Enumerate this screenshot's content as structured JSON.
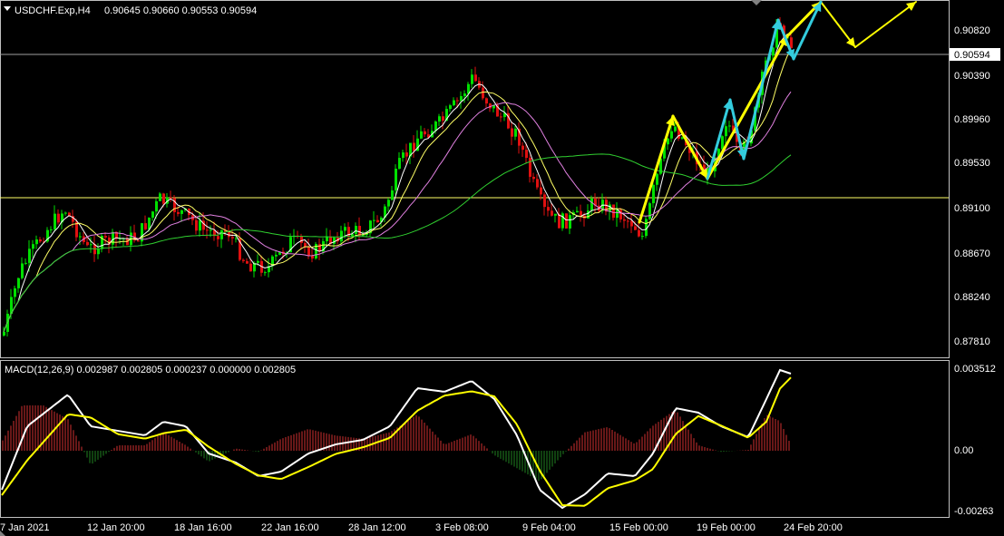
{
  "main_header": {
    "symbol": "USDCHF.Exp,H4",
    "ohlc": "0.90645 0.90660 0.90553 0.90594"
  },
  "macd_header": {
    "text": "MACD(12,26,9) 0.002987 0.002805 0.000237 0.000000 0.002805"
  },
  "price_axis": {
    "ticks": [
      "0.90820",
      "0.90390",
      "0.89960",
      "0.89530",
      "0.89100",
      "0.88670",
      "0.88240",
      "0.87810"
    ],
    "current_price": "0.90594"
  },
  "macd_axis": {
    "ticks": [
      "0.003512",
      "0.00",
      "-0.00263"
    ]
  },
  "time_axis": {
    "labels": [
      "7 Jan 2021",
      "12 Jan 20:00",
      "18 Jan 16:00",
      "22 Jan 16:00",
      "28 Jan 12:00",
      "3 Feb 08:00",
      "9 Feb 04:00",
      "15 Feb 00:00",
      "19 Feb 00:00",
      "24 Feb 20:00"
    ]
  },
  "colors": {
    "background": "#000000",
    "bull_candle": "#00e000",
    "bear_candle": "#e01010",
    "ma_fast": "#ffffff",
    "ma_mid": "#ffff66",
    "ma_slow": "#e080e0",
    "ma_long": "#30d030",
    "arrow_yellow": "#ffff00",
    "arrow_cyan": "#33ccdd",
    "macd_main": "#ffffff",
    "macd_signal": "#ffff00",
    "hist_pos": "#d03030",
    "hist_neg": "#208020",
    "grid_line": "#c0c0c0"
  }
}
